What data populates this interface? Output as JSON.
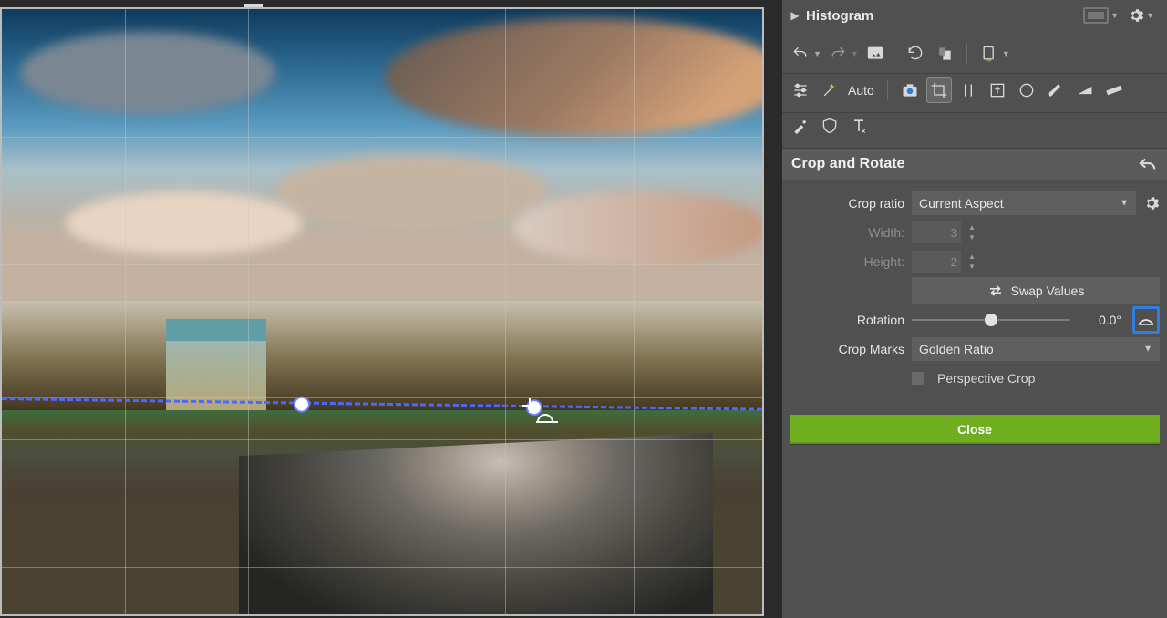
{
  "histogram": {
    "title": "Histogram"
  },
  "tools": {
    "auto_label": "Auto",
    "icons": {
      "undo": "undo-icon",
      "redo": "redo-icon",
      "photo": "photo-icon",
      "rotate_ccw": "rotate-ccw-icon",
      "rotate_cw": "rotate-cw-icon",
      "file": "file-icon",
      "sliders": "sliders-icon",
      "magic": "magic-wand-icon",
      "camera": "camera-icon",
      "crop": "crop-icon",
      "vert": "straighten-v-icon",
      "arrowbox": "arrow-box-icon",
      "circle": "circle-icon",
      "brush": "brush-icon",
      "grad": "gradient-icon",
      "measure": "ruler-icon",
      "heal": "heal-brush-icon",
      "shield": "shield-icon",
      "text": "text-icon"
    }
  },
  "section_title": "Crop and Rotate",
  "form": {
    "crop_ratio": {
      "label": "Crop ratio",
      "value": "Current Aspect"
    },
    "width": {
      "label": "Width:",
      "value": "3"
    },
    "height": {
      "label": "Height:",
      "value": "2"
    },
    "swap_label": "Swap Values",
    "rotation": {
      "label": "Rotation",
      "value": "0.0°"
    },
    "crop_marks": {
      "label": "Crop Marks",
      "value": "Golden Ratio"
    },
    "perspective": {
      "label": "Perspective Crop",
      "checked": false
    }
  },
  "close_label": "Close"
}
